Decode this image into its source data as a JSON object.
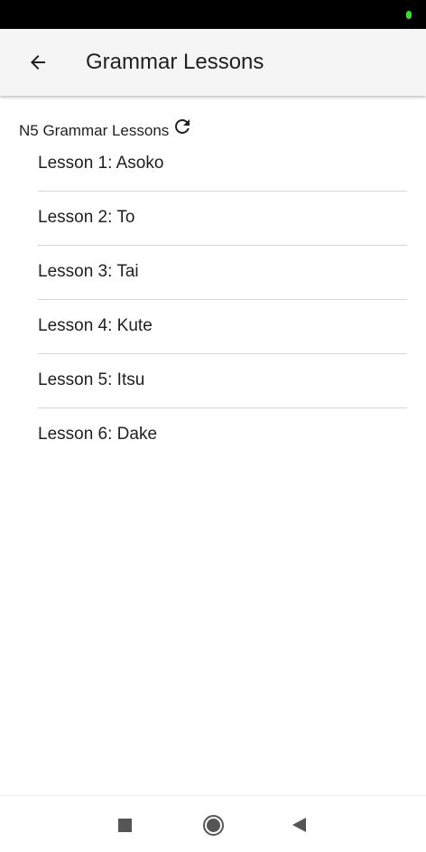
{
  "app_bar": {
    "title": "Grammar Lessons",
    "back_icon": "arrow-back-icon"
  },
  "section": {
    "title": "N5 Grammar Lessons",
    "refresh_icon": "refresh-icon"
  },
  "lessons": [
    {
      "label": "Lesson 1: Asoko"
    },
    {
      "label": "Lesson 2: To"
    },
    {
      "label": "Lesson 3: Tai"
    },
    {
      "label": "Lesson 4: Kute"
    },
    {
      "label": "Lesson 5: Itsu"
    },
    {
      "label": "Lesson 6: Dake"
    }
  ],
  "system_nav": {
    "recents_icon": "square-icon",
    "home_icon": "circle-icon",
    "back_icon": "triangle-back-icon"
  },
  "colors": {
    "status_bar": "#000000",
    "app_bar": "#f5f5f5",
    "text": "#212121",
    "divider": "#d6d6d6",
    "status_indicator": "#3ddc2f"
  }
}
